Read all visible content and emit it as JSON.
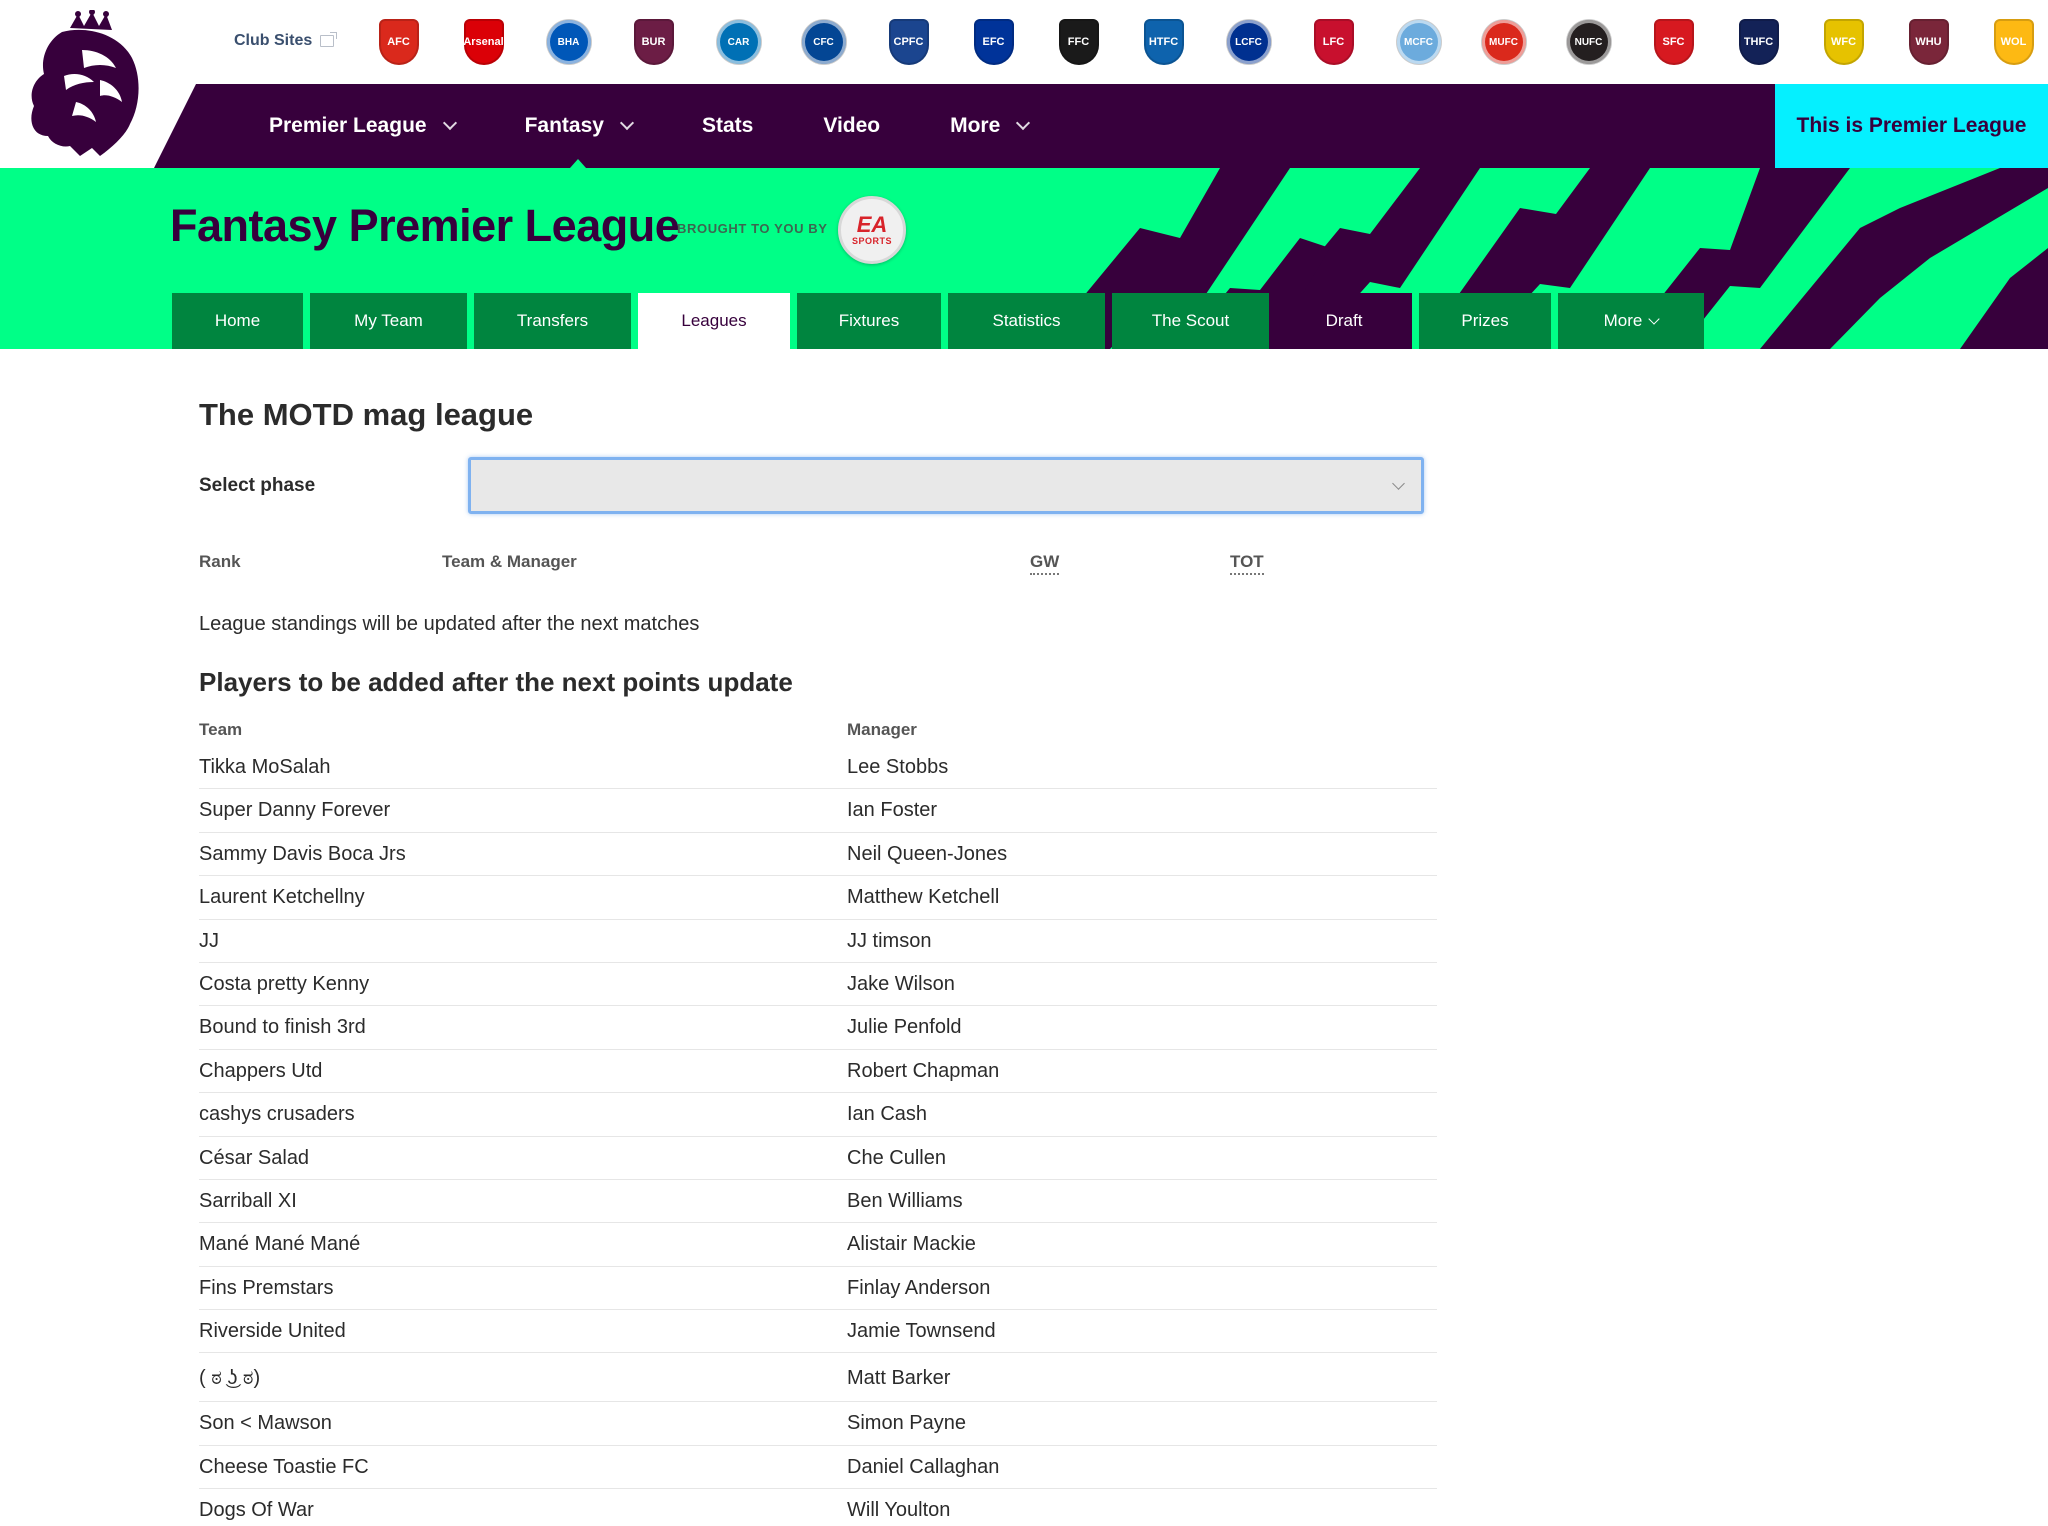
{
  "club_bar": {
    "club_sites_label": "Club Sites",
    "clubs": [
      {
        "icon": "bournemouth-crest-icon",
        "abbr": "AFC",
        "color": "#da291c",
        "shape": "shield"
      },
      {
        "icon": "arsenal-crest-icon",
        "abbr": "Arsenal",
        "color": "#db0007",
        "shape": "shield"
      },
      {
        "icon": "brighton-crest-icon",
        "abbr": "BHA",
        "color": "#0057b8",
        "shape": "round"
      },
      {
        "icon": "burnley-crest-icon",
        "abbr": "BUR",
        "color": "#6c1d45",
        "shape": "shield"
      },
      {
        "icon": "cardiff-crest-icon",
        "abbr": "CAR",
        "color": "#0070b5",
        "shape": "round"
      },
      {
        "icon": "chelsea-crest-icon",
        "abbr": "CFC",
        "color": "#034694",
        "shape": "round"
      },
      {
        "icon": "crystal-palace-crest-icon",
        "abbr": "CPFC",
        "color": "#1b458f",
        "shape": "shield"
      },
      {
        "icon": "everton-crest-icon",
        "abbr": "EFC",
        "color": "#003399",
        "shape": "shield"
      },
      {
        "icon": "fulham-crest-icon",
        "abbr": "FFC",
        "color": "#1a1a1a",
        "shape": "shield"
      },
      {
        "icon": "huddersfield-crest-icon",
        "abbr": "HTFC",
        "color": "#0e63ad",
        "shape": "shield"
      },
      {
        "icon": "leicester-crest-icon",
        "abbr": "LCFC",
        "color": "#003090",
        "shape": "round"
      },
      {
        "icon": "liverpool-crest-icon",
        "abbr": "LFC",
        "color": "#c8102e",
        "shape": "shield"
      },
      {
        "icon": "man-city-crest-icon",
        "abbr": "MCFC",
        "color": "#6cabdd",
        "shape": "round"
      },
      {
        "icon": "man-utd-crest-icon",
        "abbr": "MUFC",
        "color": "#da291c",
        "shape": "round"
      },
      {
        "icon": "newcastle-crest-icon",
        "abbr": "NUFC",
        "color": "#241f20",
        "shape": "round"
      },
      {
        "icon": "southampton-crest-icon",
        "abbr": "SFC",
        "color": "#d71920",
        "shape": "shield"
      },
      {
        "icon": "tottenham-crest-icon",
        "abbr": "THFC",
        "color": "#132257",
        "shape": "shield"
      },
      {
        "icon": "watford-crest-icon",
        "abbr": "WFC",
        "color": "#e6c200",
        "shape": "shield"
      },
      {
        "icon": "west-ham-crest-icon",
        "abbr": "WHU",
        "color": "#7a263a",
        "shape": "shield"
      },
      {
        "icon": "wolves-crest-icon",
        "abbr": "WOL",
        "color": "#fdb913",
        "shape": "shield"
      }
    ]
  },
  "main_nav": {
    "items": [
      {
        "label": "Premier League",
        "has_dropdown": true
      },
      {
        "label": "Fantasy",
        "has_dropdown": true
      },
      {
        "label": "Stats",
        "has_dropdown": false
      },
      {
        "label": "Video",
        "has_dropdown": false
      },
      {
        "label": "More",
        "has_dropdown": true
      }
    ],
    "cta": "This is Premier League"
  },
  "fantasy_header": {
    "title": "Fantasy Premier League",
    "brought_to_you_by": "BROUGHT TO YOU BY",
    "sponsor_logo": {
      "icon": "ea-sports-logo",
      "top_text": "EA",
      "bottom_text": "SPORTS"
    },
    "tabs": [
      {
        "label": "Home"
      },
      {
        "label": "My Team"
      },
      {
        "label": "Transfers"
      },
      {
        "label": "Leagues",
        "active": true
      },
      {
        "label": "Fixtures"
      },
      {
        "label": "Statistics"
      },
      {
        "label": "The Scout"
      },
      {
        "label": "Draft"
      },
      {
        "label": "Prizes"
      },
      {
        "label": "More",
        "has_dropdown": true
      }
    ]
  },
  "colors": {
    "brand_purple": "#37003c",
    "brand_green": "#00ff87",
    "tab_green": "#00853f",
    "cyan": "#05f0ff",
    "select_focus": "#7fb2f0"
  },
  "league": {
    "title": "The MOTD mag league",
    "select_phase_label": "Select phase",
    "select_phase_value": "",
    "standings_headers": {
      "rank": "Rank",
      "team_manager": "Team & Manager",
      "gw": "GW",
      "tot": "TOT"
    },
    "notice": "League standings will be updated after the next matches",
    "new_players_title": "Players to be added after the next points update",
    "new_players_headers": {
      "team": "Team",
      "manager": "Manager"
    },
    "new_players": [
      {
        "team": "Tikka MoSalah",
        "manager": "Lee Stobbs"
      },
      {
        "team": "Super Danny Forever",
        "manager": "Ian Foster"
      },
      {
        "team": "Sammy Davis Boca Jrs",
        "manager": "Neil Queen-Jones"
      },
      {
        "team": "Laurent Ketchellny",
        "manager": "Matthew Ketchell"
      },
      {
        "team": "JJ",
        "manager": "JJ timson"
      },
      {
        "team": "Costa pretty Kenny",
        "manager": "Jake Wilson"
      },
      {
        "team": "Bound to finish 3rd",
        "manager": "Julie Penfold"
      },
      {
        "team": "Chappers Utd",
        "manager": "Robert Chapman"
      },
      {
        "team": "cashys crusaders",
        "manager": "Ian Cash"
      },
      {
        "team": "César Salad",
        "manager": "Che Cullen"
      },
      {
        "team": "Sarriball XI",
        "manager": "Ben Williams"
      },
      {
        "team": "Mané Mané Mané",
        "manager": "Alistair Mackie"
      },
      {
        "team": "Fins Premstars",
        "manager": "Finlay Anderson"
      },
      {
        "team": "Riverside United",
        "manager": "Jamie Townsend"
      },
      {
        "team": "( ಠ ͜ʖ ಠ)",
        "manager": "Matt Barker"
      },
      {
        "team": "Son < Mawson",
        "manager": "Simon Payne"
      },
      {
        "team": "Cheese Toastie FC",
        "manager": "Daniel Callaghan"
      },
      {
        "team": "Dogs Of War",
        "manager": "Will Youlton"
      }
    ]
  }
}
